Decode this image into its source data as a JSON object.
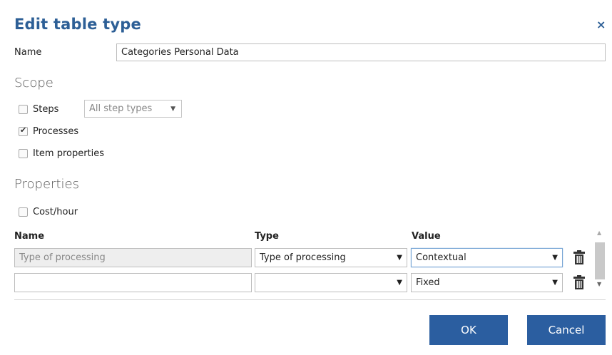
{
  "dialog": {
    "title": "Edit table type",
    "close_symbol": "×"
  },
  "name_field": {
    "label": "Name",
    "value": "Categories Personal Data"
  },
  "scope": {
    "heading": "Scope",
    "steps": {
      "label": "Steps",
      "checked": false
    },
    "step_types_select": {
      "value": "All step types"
    },
    "processes": {
      "label": "Processes",
      "checked": true
    },
    "item_properties": {
      "label": "Item properties",
      "checked": false
    }
  },
  "properties": {
    "heading": "Properties",
    "cost_hour": {
      "label": "Cost/hour",
      "checked": false
    },
    "columns": {
      "name": "Name",
      "type": "Type",
      "value": "Value"
    },
    "rows": [
      {
        "name": "Type of processing",
        "type": "Type of processing",
        "value": "Contextual"
      },
      {
        "name": "",
        "type": "",
        "value": "Fixed"
      }
    ]
  },
  "buttons": {
    "ok": "OK",
    "cancel": "Cancel"
  },
  "colors": {
    "title": "#2d5f96",
    "primary_button": "#2b5ea0"
  },
  "icons": {
    "delete": "trash-icon",
    "dropdown": "caret-down-icon",
    "close": "close-icon"
  }
}
